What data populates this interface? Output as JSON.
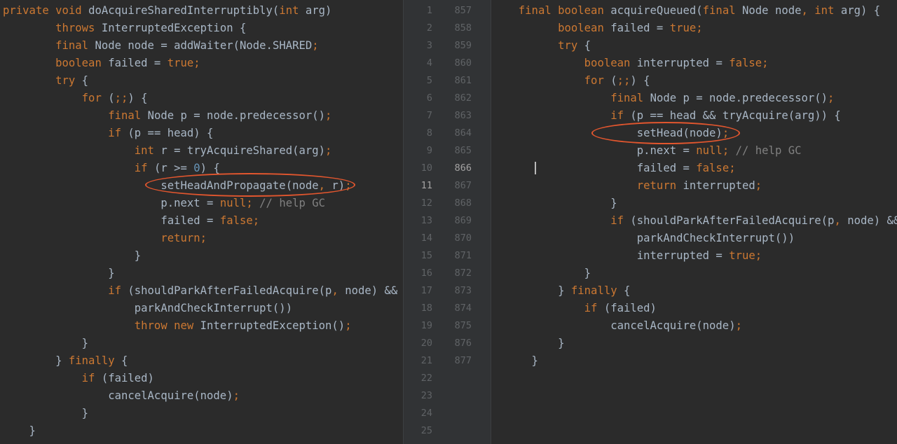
{
  "colors": {
    "background": "#2b2b2b",
    "keyword": "#cc7832",
    "identifier": "#a9b7c6",
    "number": "#6897bb",
    "comment": "#808080",
    "annotation_oval": "#e2562e"
  },
  "left_editor": {
    "lines": [
      [
        [
          "kw",
          "private void "
        ],
        [
          "p",
          "doAcquireSharedInterruptibly("
        ],
        [
          "kw",
          "int "
        ],
        [
          "p",
          "arg)"
        ]
      ],
      [
        [
          "p",
          "        "
        ],
        [
          "kw",
          "throws "
        ],
        [
          "p",
          "InterruptedException {"
        ]
      ],
      [
        [
          "p",
          "        "
        ],
        [
          "kw",
          "final "
        ],
        [
          "p",
          "Node node = addWaiter(Node."
        ],
        [
          "p",
          "SHARED"
        ],
        [
          "kw",
          ";"
        ]
      ],
      [
        [
          "p",
          "        "
        ],
        [
          "kw",
          "boolean "
        ],
        [
          "p",
          "failed = "
        ],
        [
          "kw",
          "true;"
        ]
      ],
      [
        [
          "p",
          "        "
        ],
        [
          "kw",
          "try "
        ],
        [
          "p",
          "{"
        ]
      ],
      [
        [
          "p",
          "            "
        ],
        [
          "kw",
          "for "
        ],
        [
          "p",
          "("
        ],
        [
          "kw",
          ";;"
        ],
        [
          "p",
          ") {"
        ]
      ],
      [
        [
          "p",
          "                "
        ],
        [
          "kw",
          "final "
        ],
        [
          "p",
          "Node p = node.predecessor()"
        ],
        [
          "kw",
          ";"
        ]
      ],
      [
        [
          "p",
          "                "
        ],
        [
          "kw",
          "if "
        ],
        [
          "p",
          "(p == head) {"
        ]
      ],
      [
        [
          "p",
          "                    "
        ],
        [
          "kw",
          "int "
        ],
        [
          "p",
          "r = tryAcquireShared(arg)"
        ],
        [
          "kw",
          ";"
        ]
      ],
      [
        [
          "p",
          "                    "
        ],
        [
          "kw",
          "if "
        ],
        [
          "p",
          "(r >= "
        ],
        [
          "num",
          "0"
        ],
        [
          "p",
          ") {"
        ]
      ],
      [
        [
          "p",
          "                        setHeadAndPropagate(node"
        ],
        [
          "kw",
          ", "
        ],
        [
          "p",
          "r)"
        ],
        [
          "kw",
          ";"
        ]
      ],
      [
        [
          "p",
          "                        p.next = "
        ],
        [
          "kw",
          "null; "
        ],
        [
          "cm",
          "// help GC"
        ]
      ],
      [
        [
          "p",
          "                        failed = "
        ],
        [
          "kw",
          "false;"
        ]
      ],
      [
        [
          "p",
          "                        "
        ],
        [
          "kw",
          "return;"
        ]
      ],
      [
        [
          "p",
          "                    }"
        ]
      ],
      [
        [
          "p",
          "                }"
        ]
      ],
      [
        [
          "p",
          "                "
        ],
        [
          "kw",
          "if "
        ],
        [
          "p",
          "(shouldParkAfterFailedAcquire(p"
        ],
        [
          "kw",
          ", "
        ],
        [
          "p",
          "node) &&"
        ]
      ],
      [
        [
          "p",
          "                    parkAndCheckInterrupt())"
        ]
      ],
      [
        [
          "p",
          "                    "
        ],
        [
          "kw",
          "throw new "
        ],
        [
          "p",
          "InterruptedException()"
        ],
        [
          "kw",
          ";"
        ]
      ],
      [
        [
          "p",
          "            }"
        ]
      ],
      [
        [
          "p",
          "        } "
        ],
        [
          "kw",
          "finally "
        ],
        [
          "p",
          "{"
        ]
      ],
      [
        [
          "p",
          "            "
        ],
        [
          "kw",
          "if "
        ],
        [
          "p",
          "(failed)"
        ]
      ],
      [
        [
          "p",
          "                cancelAcquire(node)"
        ],
        [
          "kw",
          ";"
        ]
      ],
      [
        [
          "p",
          "            }"
        ]
      ],
      [
        [
          "p",
          "    }"
        ]
      ]
    ]
  },
  "gutter": {
    "left_numbers": [
      "1",
      "2",
      "3",
      "4",
      "5",
      "6",
      "7",
      "8",
      "9",
      "10",
      "11",
      "12",
      "13",
      "14",
      "15",
      "16",
      "17",
      "18",
      "19",
      "20",
      "21",
      "22",
      "23",
      "24",
      "25"
    ],
    "right_numbers": [
      "857",
      "858",
      "859",
      "860",
      "861",
      "862",
      "863",
      "864",
      "865",
      "866",
      "867",
      "868",
      "869",
      "870",
      "871",
      "872",
      "873",
      "874",
      "875",
      "876",
      "877"
    ]
  },
  "right_editor": {
    "lines": [
      [
        [
          "p",
          "  "
        ],
        [
          "kw",
          "final boolean "
        ],
        [
          "p",
          "acquireQueued("
        ],
        [
          "kw",
          "final "
        ],
        [
          "p",
          "Node node"
        ],
        [
          "kw",
          ", int "
        ],
        [
          "p",
          "arg) {"
        ]
      ],
      [
        [
          "p",
          "        "
        ],
        [
          "kw",
          "boolean "
        ],
        [
          "p",
          "failed = "
        ],
        [
          "kw",
          "true;"
        ]
      ],
      [
        [
          "p",
          "        "
        ],
        [
          "kw",
          "try "
        ],
        [
          "p",
          "{"
        ]
      ],
      [
        [
          "p",
          "            "
        ],
        [
          "kw",
          "boolean "
        ],
        [
          "p",
          "interrupted = "
        ],
        [
          "kw",
          "false;"
        ]
      ],
      [
        [
          "p",
          "            "
        ],
        [
          "kw",
          "for "
        ],
        [
          "p",
          "("
        ],
        [
          "kw",
          ";;"
        ],
        [
          "p",
          ") {"
        ]
      ],
      [
        [
          "p",
          "                "
        ],
        [
          "kw",
          "final "
        ],
        [
          "p",
          "Node p = node.predecessor()"
        ],
        [
          "kw",
          ";"
        ]
      ],
      [
        [
          "p",
          "                "
        ],
        [
          "kw",
          "if "
        ],
        [
          "p",
          "(p == head && tryAcquire(arg)) {"
        ]
      ],
      [
        [
          "p",
          "                    setHead(node)"
        ],
        [
          "kw",
          ";"
        ]
      ],
      [
        [
          "p",
          "                    p.next = "
        ],
        [
          "kw",
          "null; "
        ],
        [
          "cm",
          "// help GC"
        ]
      ],
      [
        [
          "p",
          "                    failed = "
        ],
        [
          "kw",
          "false;"
        ]
      ],
      [
        [
          "p",
          "                    "
        ],
        [
          "kw",
          "return "
        ],
        [
          "p",
          "interrupted"
        ],
        [
          "kw",
          ";"
        ]
      ],
      [
        [
          "p",
          "                }"
        ]
      ],
      [
        [
          "p",
          "                "
        ],
        [
          "kw",
          "if "
        ],
        [
          "p",
          "(shouldParkAfterFailedAcquire(p"
        ],
        [
          "kw",
          ", "
        ],
        [
          "p",
          "node) &&"
        ]
      ],
      [
        [
          "p",
          "                    parkAndCheckInterrupt())"
        ]
      ],
      [
        [
          "p",
          "                    interrupted = "
        ],
        [
          "kw",
          "true;"
        ]
      ],
      [
        [
          "p",
          "            }"
        ]
      ],
      [
        [
          "p",
          "        } "
        ],
        [
          "kw",
          "finally "
        ],
        [
          "p",
          "{"
        ]
      ],
      [
        [
          "p",
          "            "
        ],
        [
          "kw",
          "if "
        ],
        [
          "p",
          "(failed)"
        ]
      ],
      [
        [
          "p",
          "                cancelAcquire(node)"
        ],
        [
          "kw",
          ";"
        ]
      ],
      [
        [
          "p",
          "        }"
        ]
      ],
      [
        [
          "p",
          "    }"
        ]
      ]
    ]
  }
}
